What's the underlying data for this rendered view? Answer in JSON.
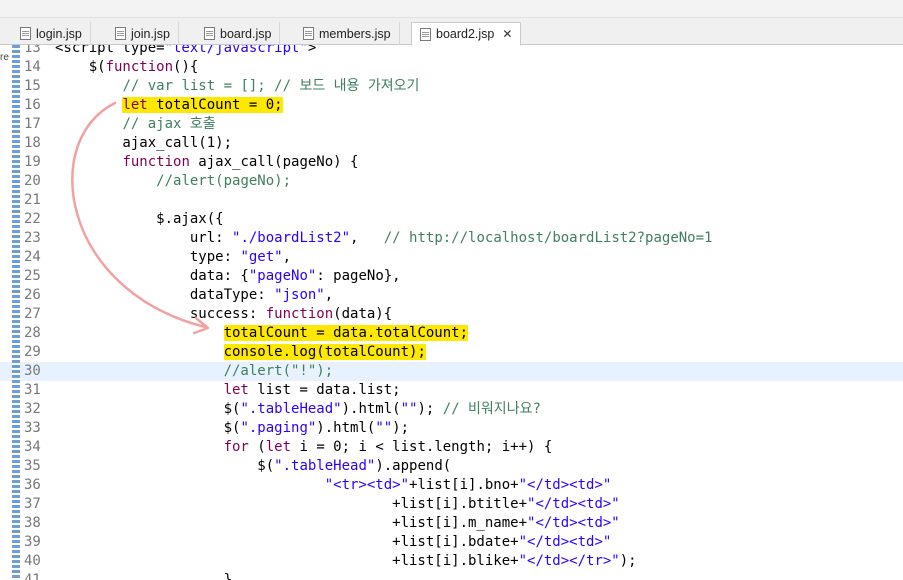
{
  "tabs": [
    {
      "label": "login.jsp",
      "active": false
    },
    {
      "label": "join.jsp",
      "active": false
    },
    {
      "label": "board.jsp",
      "active": false
    },
    {
      "label": "members.jsp",
      "active": false
    },
    {
      "label": "board2.jsp",
      "active": true
    }
  ],
  "left_marker": "re",
  "code_lines": [
    {
      "num": "13",
      "text": "<script type=\"text/javascript\">"
    },
    {
      "num": "14",
      "text": "    $(function(){"
    },
    {
      "num": "15",
      "text": "        // var list = []; // 보드 내용 가져오기"
    },
    {
      "num": "16",
      "text": "        let totalCount = 0;"
    },
    {
      "num": "17",
      "text": "        // ajax 호출"
    },
    {
      "num": "18",
      "text": "        ajax_call(1);"
    },
    {
      "num": "19",
      "text": "        function ajax_call(pageNo) {"
    },
    {
      "num": "20",
      "text": "            //alert(pageNo);"
    },
    {
      "num": "21",
      "text": ""
    },
    {
      "num": "22",
      "text": "            $.ajax({"
    },
    {
      "num": "23",
      "text": "                url: \"./boardList2\",   // http://localhost/boardList2?pageNo=1"
    },
    {
      "num": "24",
      "text": "                type: \"get\","
    },
    {
      "num": "25",
      "text": "                data: {\"pageNo\": pageNo},"
    },
    {
      "num": "26",
      "text": "                dataType: \"json\","
    },
    {
      "num": "27",
      "text": "                success: function(data){"
    },
    {
      "num": "28",
      "text": "                    totalCount = data.totalCount;"
    },
    {
      "num": "29",
      "text": "                    console.log(totalCount);"
    },
    {
      "num": "30",
      "text": "                    //alert(\"!\");"
    },
    {
      "num": "31",
      "text": "                    let list = data.list;"
    },
    {
      "num": "32",
      "text": "                    $(\".tableHead\").html(\"\"); // 비워지나요?"
    },
    {
      "num": "33",
      "text": "                    $(\".paging\").html(\"\");"
    },
    {
      "num": "34",
      "text": "                    for (let i = 0; i < list.length; i++) {"
    },
    {
      "num": "35",
      "text": "                        $(\".tableHead\").append("
    },
    {
      "num": "36",
      "text": "                                \"<tr><td>\"+list[i].bno+\"</td><td>\""
    },
    {
      "num": "37",
      "text": "                                        +list[i].btitle+\"</td><td>\""
    },
    {
      "num": "38",
      "text": "                                        +list[i].m_name+\"</td><td>\""
    },
    {
      "num": "39",
      "text": "                                        +list[i].bdate+\"</td><td>\""
    },
    {
      "num": "40",
      "text": "                                        +list[i].blike+\"</td></tr>\");"
    },
    {
      "num": "41",
      "text": "                    }"
    }
  ],
  "current_line": "30",
  "colors": {
    "keyword": "#7f0055",
    "string": "#2a00ff",
    "comment": "#3f7f5f",
    "highlight": "#ffe800",
    "annotation_arrow": "#f4a0a0"
  }
}
